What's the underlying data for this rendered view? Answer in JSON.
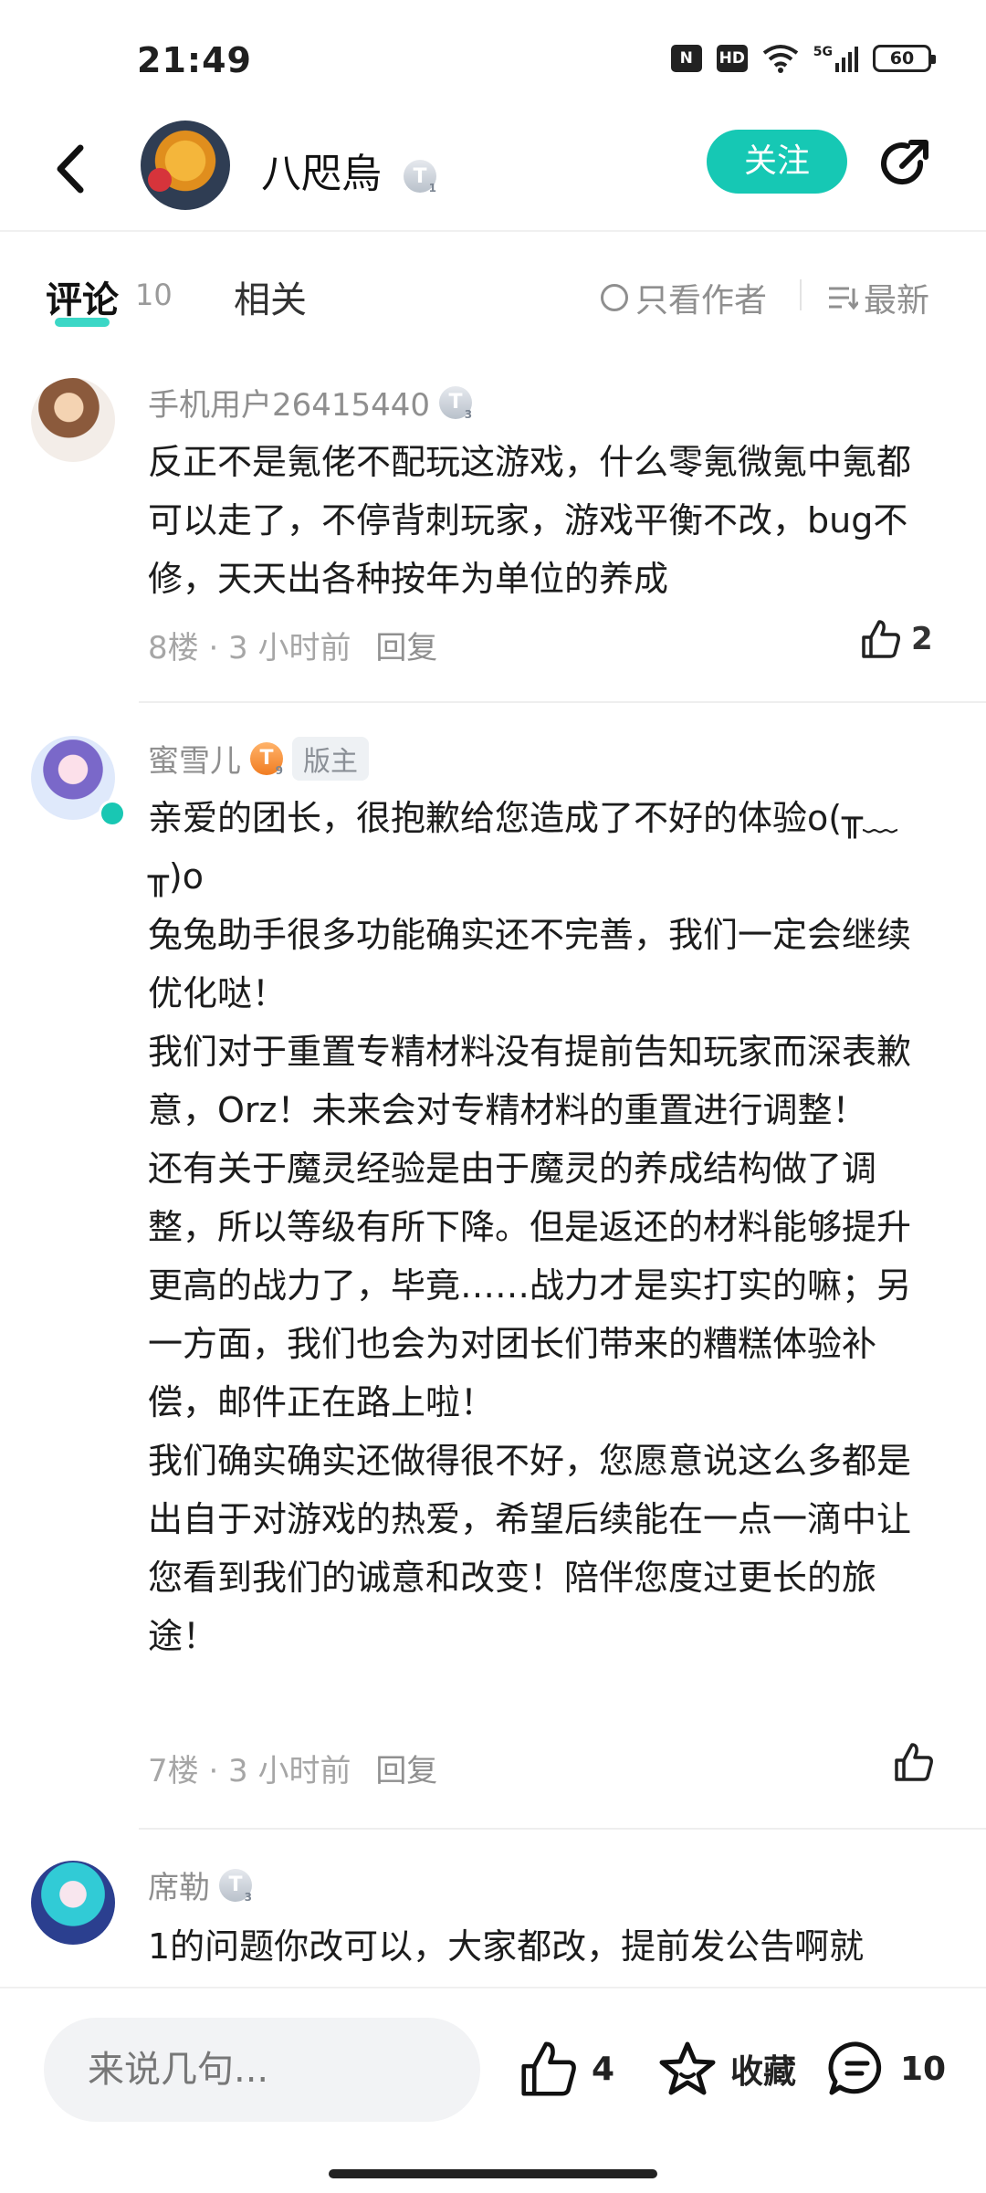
{
  "status_bar": {
    "time": "21:49",
    "icons": [
      "nfc-icon",
      "hd-icon",
      "wifi-icon",
      "5g-signal-icon"
    ],
    "network": "5G",
    "hd_label": "HD",
    "battery": "60"
  },
  "header": {
    "author_name": "八咫烏",
    "author_level": "T",
    "author_level_num": "1",
    "follow_label": "关注"
  },
  "tabs": {
    "comments_label": "评论",
    "comments_count": "10",
    "related_label": "相关",
    "only_author_label": "只看作者",
    "sort_label": "最新"
  },
  "comments": [
    {
      "user": "手机用户26415440",
      "level": "T",
      "level_num": "3",
      "text": "反正不是氪佬不配玩这游戏，什么零氪微氪中氪都可以走了，不停背刺玩家，游戏平衡不改，bug不修，天天出各种按年为单位的养成",
      "floor": "8楼 · 3 小时前",
      "reply": "回复",
      "likes": "2"
    },
    {
      "user": "蜜雪儿",
      "level": "T",
      "level_num": "9",
      "badge": "版主",
      "text": "亲爱的团长，很抱歉给您造成了不好的体验o(╥﹏╥)o\n兔兔助手很多功能确实还不完善，我们一定会继续优化哒！\n我们对于重置专精材料没有提前告知玩家而深表歉意，Orz！未来会对专精材料的重置进行调整！\n还有关于魔灵经验是由于魔灵的养成结构做了调整，所以等级有所下降。但是返还的材料能够提升更高的战力了，毕竟……战力才是实打实的嘛；另一方面，我们也会为对团长们带来的糟糕体验补偿，邮件正在路上啦！\n我们确实确实还做得很不好，您愿意说这么多都是出自于对游戏的热爱，希望后续能在一点一滴中让您看到我们的诚意和改变！陪伴您度过更长的旅途！",
      "floor": "7楼 · 3 小时前",
      "reply": "回复",
      "likes": ""
    },
    {
      "user": "席勒",
      "level": "T",
      "level_num": "3",
      "text": "1的问题你改可以，大家都改，提前发公告啊就"
    }
  ],
  "bottom_bar": {
    "input_placeholder": "来说几句...",
    "like_count": "4",
    "favorite_label": "收藏",
    "comment_count": "10"
  }
}
